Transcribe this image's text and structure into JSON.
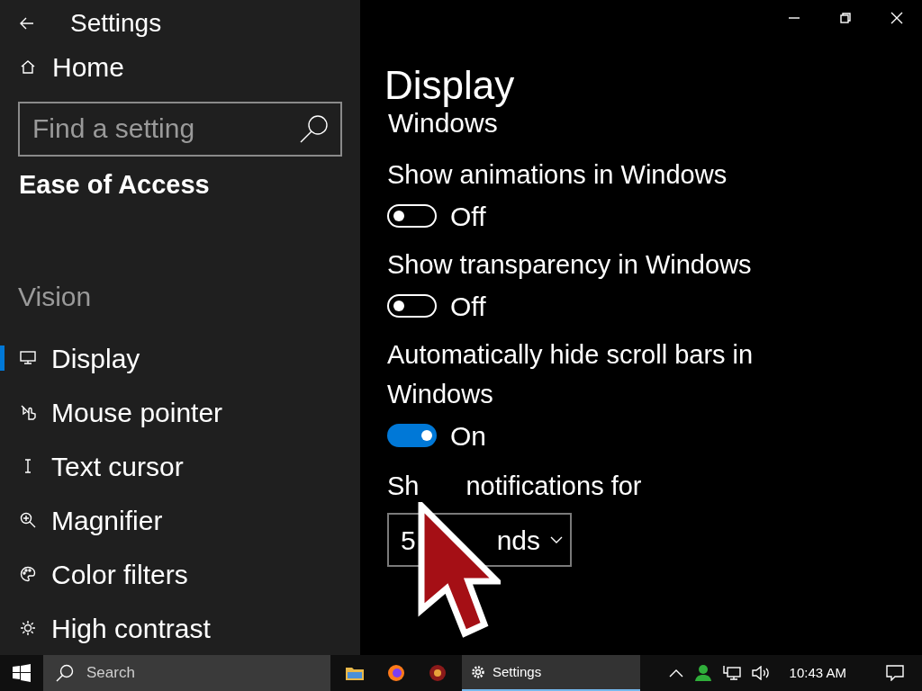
{
  "window": {
    "title": "Settings"
  },
  "sidebar": {
    "home": "Home",
    "search": {
      "placeholder": "Find a setting"
    },
    "section": "Ease of Access",
    "group": "Vision",
    "items": [
      {
        "label": "Display",
        "selected": true
      },
      {
        "label": "Mouse pointer",
        "selected": false
      },
      {
        "label": "Text cursor",
        "selected": false
      },
      {
        "label": "Magnifier",
        "selected": false
      },
      {
        "label": "Color filters",
        "selected": false
      },
      {
        "label": "High contrast",
        "selected": false
      }
    ]
  },
  "page": {
    "title": "Display",
    "cut_heading": "Windows",
    "settings": [
      {
        "kind": "toggle",
        "label": "Show animations in Windows",
        "on": false,
        "state_text": "Off"
      },
      {
        "kind": "toggle",
        "label": "Show transparency in Windows",
        "on": false,
        "state_text": "Off"
      },
      {
        "kind": "toggle",
        "label": "Automatically hide scroll bars in Windows",
        "on": true,
        "state_text": "On"
      },
      {
        "kind": "dropdown",
        "label_parts": [
          "Sh",
          "notifications for"
        ],
        "value_parts": [
          "5",
          "nds"
        ]
      }
    ]
  },
  "taskbar": {
    "search": {
      "placeholder": "Search"
    },
    "apps": [
      {
        "label": "Settings",
        "active": true
      }
    ],
    "time": "10:43 AM"
  }
}
